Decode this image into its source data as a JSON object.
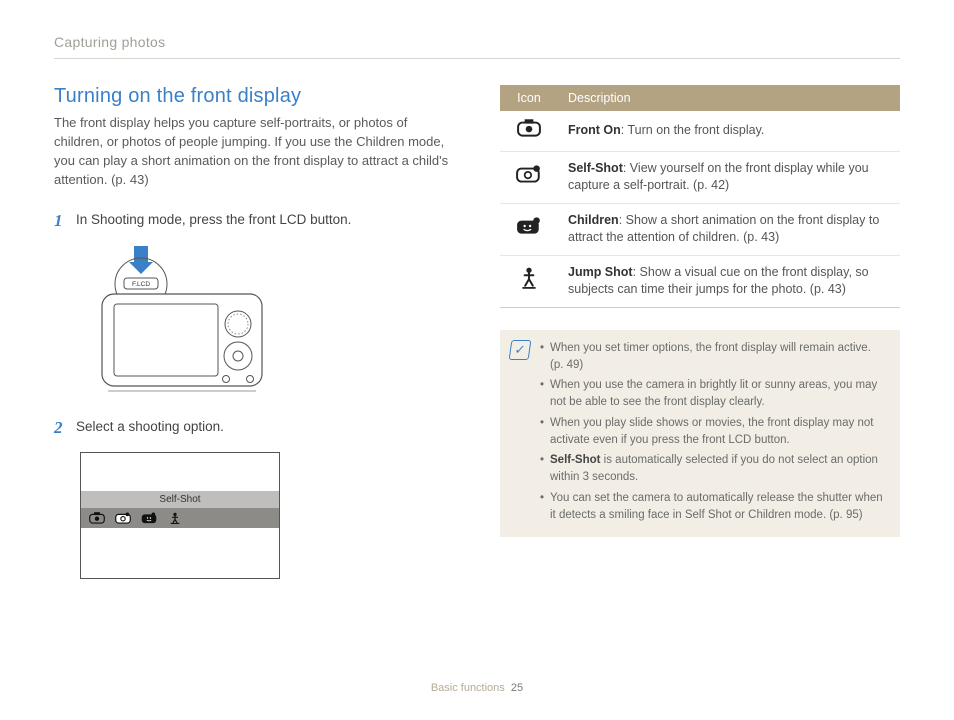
{
  "section_header": "Capturing photos",
  "title": "Turning on the front display",
  "intro": "The front display helps you capture self-portraits, or photos of children, or photos of people jumping. If you use the Children mode, you can play a short animation on the front display to attract a child's attention. (p. 43)",
  "steps": {
    "s1": {
      "num": "1",
      "text": "In Shooting mode, press the front LCD button."
    },
    "s2": {
      "num": "2",
      "text": "Select a shooting option."
    }
  },
  "camera_label": "F.LCD",
  "option_label": "Self-Shot",
  "table": {
    "head_icon": "Icon",
    "head_desc": "Description",
    "rows": [
      {
        "name": "Front On",
        "desc": ": Turn on the front display."
      },
      {
        "name": "Self-Shot",
        "desc": ": View yourself on the front display while you capture a self-portrait. (p. 42)"
      },
      {
        "name": "Children",
        "desc": ": Show a short animation on the front display to attract the attention of children. (p. 43)"
      },
      {
        "name": "Jump Shot",
        "desc": ": Show a visual cue on the front display, so subjects can time their jumps for the photo. (p. 43)"
      }
    ]
  },
  "notes": [
    "When you set timer options, the front display will remain active. (p. 49)",
    "When you use the camera in brightly lit or sunny areas, you may not be able to see the front display clearly.",
    "When you play slide shows or movies, the front display may not activate even if you press the front LCD button.",
    "<b>Self-Shot</b> is automatically selected if you do not select an option within 3 seconds.",
    "You can set the camera to automatically release the shutter when it detects a smiling face in Self Shot or Children mode. (p. 95)"
  ],
  "footer_label": "Basic functions",
  "footer_page": "25"
}
